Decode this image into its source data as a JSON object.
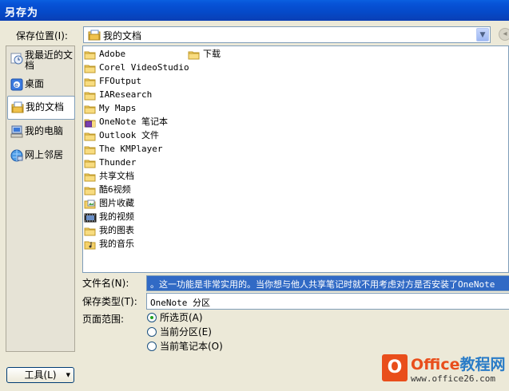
{
  "window": {
    "title": "另存为"
  },
  "location": {
    "label": "保存位置(I):",
    "value": "我的文档"
  },
  "places": [
    {
      "label": "我最近的文档",
      "icon": "recent-documents-icon"
    },
    {
      "label": "桌面",
      "icon": "desktop-icon"
    },
    {
      "label": "我的文档",
      "icon": "my-documents-icon",
      "active": true
    },
    {
      "label": "我的电脑",
      "icon": "my-computer-icon"
    },
    {
      "label": "网上邻居",
      "icon": "network-places-icon"
    }
  ],
  "files": [
    {
      "name": "Adobe",
      "icon": "folder-icon"
    },
    {
      "name": "Corel VideoStudio",
      "icon": "folder-icon"
    },
    {
      "name": "FFOutput",
      "icon": "folder-icon"
    },
    {
      "name": "IAResearch",
      "icon": "folder-icon"
    },
    {
      "name": "My Maps",
      "icon": "folder-icon"
    },
    {
      "name": "OneNote 笔记本",
      "icon": "onenote-notebook-icon"
    },
    {
      "name": "Outlook 文件",
      "icon": "folder-icon"
    },
    {
      "name": "The KMPlayer",
      "icon": "folder-icon"
    },
    {
      "name": "Thunder",
      "icon": "folder-icon"
    },
    {
      "name": "共享文档",
      "icon": "folder-icon"
    },
    {
      "name": "酷6视频",
      "icon": "folder-icon"
    },
    {
      "name": "图片收藏",
      "icon": "pictures-folder-icon"
    },
    {
      "name": "我的视频",
      "icon": "videos-folder-icon"
    },
    {
      "name": "我的图表",
      "icon": "folder-icon"
    },
    {
      "name": "我的音乐",
      "icon": "music-folder-icon"
    },
    {
      "name": "下载",
      "icon": "folder-icon"
    }
  ],
  "form": {
    "filename_label": "文件名(N):",
    "filename_value": "。这一功能是非常实用的。当你想与他人共享笔记时就不用考虑对方是否安装了OneNote",
    "type_label": "保存类型(T):",
    "type_value": "OneNote 分区",
    "range_label": "页面范围:",
    "range_options": [
      {
        "label": "所选页(A)",
        "selected": true
      },
      {
        "label": "当前分区(E)",
        "selected": false
      },
      {
        "label": "当前笔记本(O)",
        "selected": false
      }
    ]
  },
  "tools_button": "工具(L)",
  "watermark": {
    "logo": "O",
    "brand_a": "Office",
    "brand_b": "教程网",
    "site": "www.office26.com"
  },
  "colors": {
    "titlebar": "#0a53d6",
    "selection": "#316ac5",
    "folder": "#f5d16a",
    "dialog_bg": "#ece9d8"
  }
}
